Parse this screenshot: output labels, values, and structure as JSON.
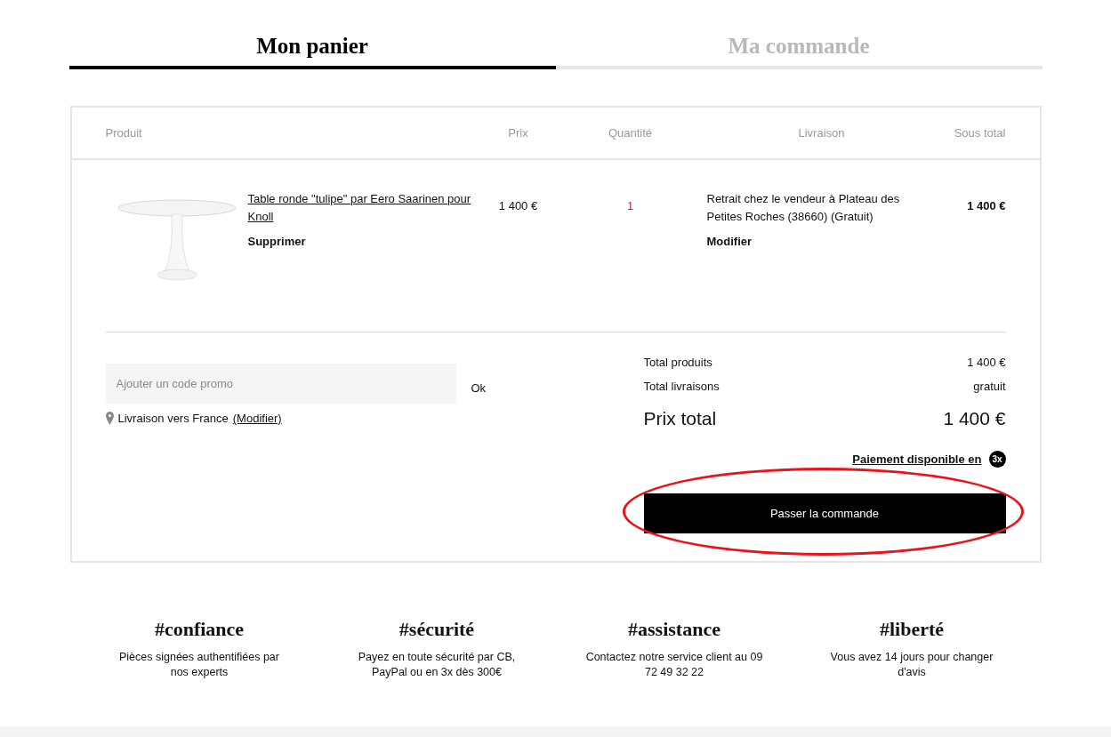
{
  "tabs": [
    {
      "label": "Mon panier",
      "selected": true
    },
    {
      "label": "Ma commande",
      "selected": false
    }
  ],
  "cart": {
    "columns": [
      "Produit",
      "Prix",
      "Quantité",
      "Livraison",
      "Sous total"
    ],
    "rows": [
      {
        "product": "Table ronde \"tulipe\" par Eero Saarinen pour Knoll",
        "remove": "Supprimer",
        "price": "1 400 €",
        "quantity": "1",
        "delivery": "Retrait chez le vendeur à Plateau des Petites Roches (38660) (Gratuit)",
        "modify": "Modifier",
        "subtotal": "1 400 €"
      }
    ],
    "promo": {
      "placeholder": "Ajouter un code promo",
      "button": "Ok"
    },
    "shipping": {
      "text": "Livraison vers France",
      "link": "(Modifier)"
    },
    "totals": [
      {
        "label": "Total produits",
        "value": "1 400 €"
      },
      {
        "label": "Total livraisons",
        "value": "gratuit"
      }
    ],
    "grand_total": {
      "label": "Prix total",
      "value": "1 400 €"
    },
    "installments": {
      "text": "Paiement disponible en",
      "badge": "3x"
    },
    "checkout": "Passer la commande"
  },
  "features": [
    {
      "title": "#confiance",
      "text": "Pièces signées authentifiées par nos experts"
    },
    {
      "title": "#sécurité",
      "text": "Payez en toute sécurité par CB, PayPal ou en 3x dès 300€"
    },
    {
      "title": "#assistance",
      "text": "Contactez notre service client au 09 72 49 32 22"
    },
    {
      "title": "#liberté",
      "text": "Vous avez 14 jours pour changer d'avis"
    }
  ]
}
